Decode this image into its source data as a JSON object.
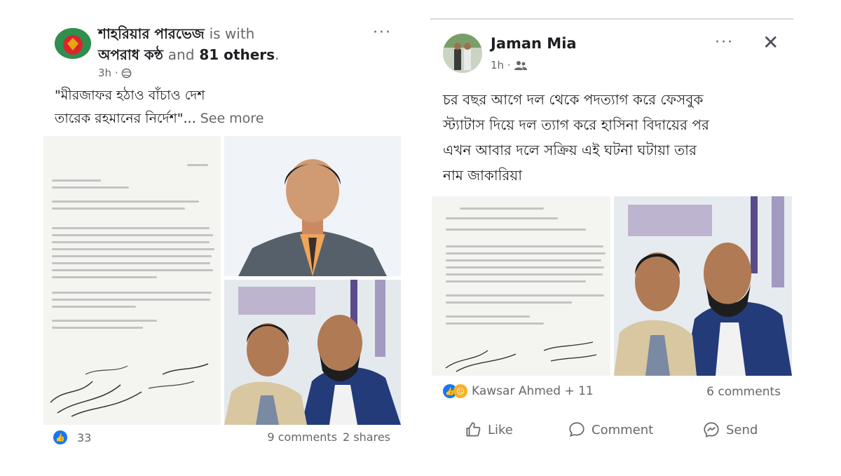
{
  "left_post": {
    "author": "শাহরিয়ার পারভেজ",
    "with_text": "is with",
    "tagged": "অপরাধ কন্ঠ",
    "and_text": "and",
    "others": "81 others",
    "period": ".",
    "time": "3h ·",
    "privacy_icon": "globe-icon",
    "more_label": "···",
    "text_line1": "\"মীরজাফর হঠাও বাঁচাও দেশ",
    "text_line2": "তারেক রহমানের নির্দেশ\"...",
    "see_more": "See more",
    "reaction_count": "33",
    "comments": "9 comments",
    "shares": "2 shares"
  },
  "right_post": {
    "author": "Jaman Mia",
    "time": "1h ·",
    "privacy_icon": "friends-icon",
    "more_label": "···",
    "close_label": "✕",
    "text_lines": [
      "চর বছর আগে দল থেকে পদত্যাগ করে ফেসবুক",
      "স্ট্যাটাস দিয়ে দল ত্যাগ করে হাসিনা বিদায়ের পর",
      "এখন আবার দলে সক্রিয় এই ঘটনা ঘটায়া তার",
      "নাম জাকারিয়া"
    ],
    "reactions_label": "Kawsar Ahmed + 11",
    "comments": "6 comments",
    "actions": {
      "like": "Like",
      "comment": "Comment",
      "send": "Send"
    }
  },
  "colors": {
    "like_blue": "#1877f2",
    "sad_yellow": "#f7b125",
    "text": "#1c1e21",
    "meta_gray": "#65676b"
  }
}
